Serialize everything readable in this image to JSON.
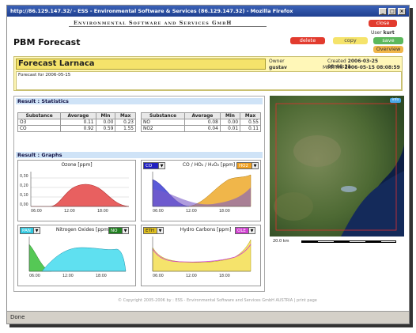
{
  "browser": {
    "title": "http://86.129.147.32/ - ESS - Environmental Software & Services (86.129.147.32) - Mozilla Firefox",
    "status": "Done"
  },
  "header": {
    "company": "Environmental Software and Services GmbH",
    "page_title": "PBM Forecast",
    "user_label": "User",
    "user_value": "kurt"
  },
  "buttons": {
    "close": "close",
    "delete": "delete",
    "copy": "copy",
    "save": "save",
    "overview": "Overview"
  },
  "forecast": {
    "name": "Forecast Larnaca",
    "description": "Forecast for 2006-05-15",
    "owner_label": "Owner",
    "owner": "gustav",
    "created_label": "Created",
    "created": "2006-03-25 08:46:31",
    "modified_label": "Modified",
    "modified": "2006-05-15 08:08:59"
  },
  "statistics": {
    "header": "Result : Statistics",
    "columns": [
      "Substance",
      "Average",
      "Min",
      "Max"
    ],
    "left_rows": [
      [
        "O3",
        "0.11",
        "0.00",
        "0.23"
      ],
      [
        "CO",
        "0.92",
        "0.59",
        "1.55"
      ]
    ],
    "right_rows": [
      [
        "NO",
        "0.08",
        "0.00",
        "0.55"
      ],
      [
        "NO2",
        "0.04",
        "0.01",
        "0.11"
      ]
    ]
  },
  "graphs": {
    "header": "Result : Graphs",
    "ozone": {
      "title": "Ozone [ppm]"
    },
    "co": {
      "title": "CO / HO₂ / H₂O₂ [ppm]",
      "left_select": "CO",
      "right_select": "HO2"
    },
    "nox": {
      "title": "Nitrogen Oxides [ppm]",
      "left_select": "PAN",
      "right_select": "NO"
    },
    "hc": {
      "title": "Hydro Carbons [ppm]",
      "left_select": "ETH",
      "right_select": "OLE"
    },
    "time_ticks": [
      "06:00",
      "12:00",
      "18:00"
    ],
    "ozone_yticks": [
      "0,30",
      "0,20",
      "0,10",
      "0,00"
    ]
  },
  "map": {
    "scale": "20.0 km",
    "badge": "info"
  },
  "footer": "© Copyright 2005-2006 by : ESS - Environmental Software and Services GmbH AUSTRIA | print page",
  "colors": {
    "ozone_fill": "#e86060",
    "co_fill": "#5a5ad8",
    "ho2_fill": "#f0b64a",
    "pan_fill": "#5fe0f0",
    "no_fill": "#55c855",
    "eth_fill": "#f5e36b",
    "ole_fill": "#d060d0"
  }
}
